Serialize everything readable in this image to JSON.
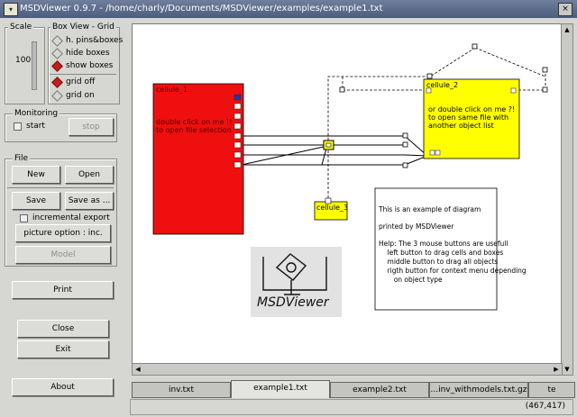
{
  "window": {
    "title": "MSDViewer 0.9.7 - /home/charly/Documents/MSDViewer/examples/example1.txt",
    "close_glyph": "×"
  },
  "scale": {
    "label": "Scale",
    "value": "100"
  },
  "box_view": {
    "label": "Box View - Grid",
    "options": [
      {
        "label": "h. pins&boxes",
        "selected": false
      },
      {
        "label": "hide boxes",
        "selected": false
      },
      {
        "label": "show boxes",
        "selected": true
      }
    ],
    "grid": [
      {
        "label": "grid off",
        "selected": true
      },
      {
        "label": "grid on",
        "selected": false
      }
    ]
  },
  "monitoring": {
    "label": "Monitoring",
    "start_label": "start",
    "stop_label": "stop"
  },
  "file": {
    "label": "File",
    "new_label": "New",
    "open_label": "Open",
    "save_label": "Save",
    "save_as_label": "Save as ...",
    "incremental_label": "incremental export",
    "picture_option_label": "picture option : inc.",
    "model_label": "Model"
  },
  "print_label": "Print",
  "close_label": "Close",
  "exit_label": "Exit",
  "about_label": "About",
  "diagram": {
    "red_cell_title": "cellule_1",
    "red_cell_lines": [
      "double click on me !!",
      "to open file selection"
    ],
    "yellow_cell_title": "cellule_2",
    "yellow_cell_lines": [
      "or double click on me ?!",
      "to open same file with",
      "another object list"
    ],
    "small_cell_title": "cellule_3",
    "info_lines": [
      "This is an example of diagram",
      "",
      "printed by MSDViewer",
      "",
      "Help: The 3 mouse buttons are usefull",
      "    left button to drag cells and boxes",
      "    middle button to drag all objects",
      "    rigth button for context menu depending",
      "       on object type"
    ],
    "logo_text": "MSDViewer"
  },
  "tabs": [
    {
      "label": "inv.txt",
      "active": false
    },
    {
      "label": "example1.txt",
      "active": true
    },
    {
      "label": "example2.txt",
      "active": false
    },
    {
      "label": "...inv_withmodels.txt.gz",
      "active": false
    },
    {
      "label": "te",
      "active": false
    }
  ],
  "status": {
    "coords": "(467,417)"
  },
  "colors": {
    "red_cell": "#ef0f0f",
    "yellow_cell": "#ffff00",
    "title_bar": "#5a6a8a"
  }
}
